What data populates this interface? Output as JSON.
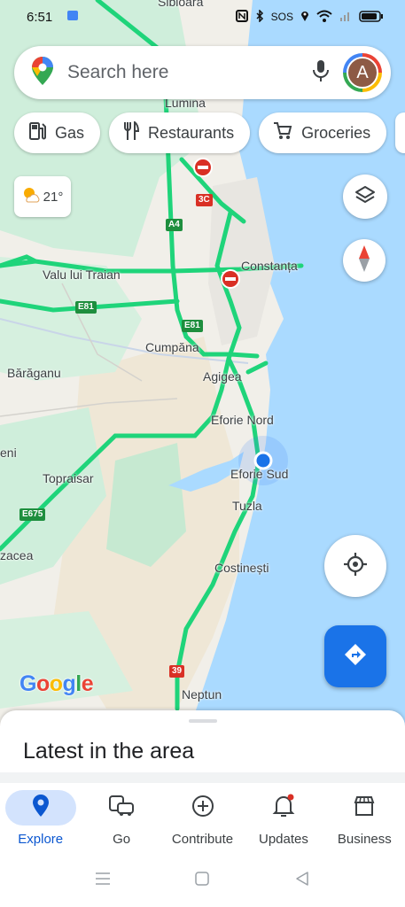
{
  "status_bar": {
    "time": "6:51",
    "sos": "SOS",
    "icons": [
      "calendar-icon",
      "nfc-icon",
      "bluetooth-icon",
      "location-icon",
      "wifi-icon",
      "signal-icon",
      "battery-icon"
    ]
  },
  "search": {
    "placeholder": "Search here",
    "avatar_letter": "A"
  },
  "chips": [
    {
      "label": "Gas",
      "icon": "gas-station-icon"
    },
    {
      "label": "Restaurants",
      "icon": "restaurant-icon"
    },
    {
      "label": "Groceries",
      "icon": "cart-icon"
    }
  ],
  "weather": {
    "temp": "21°",
    "icon": "partly-cloudy-icon"
  },
  "map": {
    "labels": {
      "sibioara": "Sibioara",
      "lumina": "Lumina",
      "valu_lui_traian": "Valu lui Traian",
      "constanta": "Constanța",
      "cumpana": "Cumpăna",
      "baraganu": "Bărăganu",
      "agigea": "Agigea",
      "eforie_nord": "Eforie Nord",
      "eforie_sud": "Eforie Sud",
      "topraisar": "Topraisar",
      "eni": "eni",
      "tuzla": "Tuzla",
      "zacea": "zacea",
      "costinesti": "Costinești",
      "neptun": "Neptun"
    },
    "shields": {
      "a4": "A4",
      "e81_a": "E81",
      "e81_b": "E81",
      "e675": "E675",
      "r3c": "3C",
      "r39": "39"
    },
    "google": [
      "G",
      "o",
      "o",
      "g",
      "l",
      "e"
    ],
    "colors": {
      "water": "#aadaff",
      "land": "#f1efe9",
      "green": "#c8ebd3",
      "highway": "#1fd47a",
      "accent": "#1a73e8"
    }
  },
  "bottom_sheet": {
    "title": "Latest in the area"
  },
  "nav": [
    {
      "label": "Explore",
      "icon": "explore-pin-icon",
      "active": true
    },
    {
      "label": "Go",
      "icon": "commute-car-icon",
      "active": false
    },
    {
      "label": "Contribute",
      "icon": "add-circle-icon",
      "active": false
    },
    {
      "label": "Updates",
      "icon": "bell-icon",
      "active": false
    },
    {
      "label": "Business",
      "icon": "storefront-icon",
      "active": false
    }
  ]
}
